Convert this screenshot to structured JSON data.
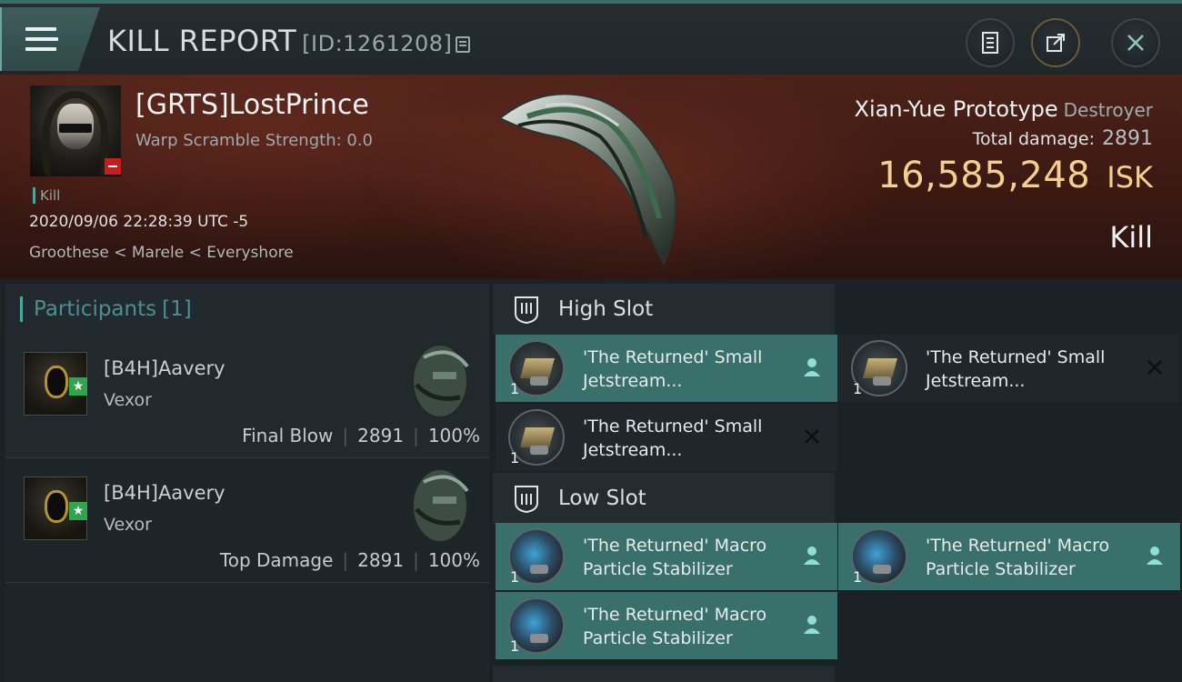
{
  "header": {
    "title": "KILL REPORT",
    "id_label": "[ID:1261208]"
  },
  "victim": {
    "name": "[GRTS]LostPrince",
    "warp_scramble": "Warp Scramble Strength: 0.0",
    "tag": "Kill",
    "timestamp": "2020/09/06 22:28:39 UTC -5",
    "location": "Groothese < Marele < Everyshore",
    "ship_name": "Xian-Yue Prototype",
    "ship_class": "Destroyer",
    "total_damage_label": "Total damage:",
    "total_damage": "2891",
    "isk_value": "16,585,248",
    "isk_unit": "ISK",
    "result": "Kill"
  },
  "participants": {
    "title": "Participants",
    "count": "[1]",
    "rows": [
      {
        "name": "[B4H]Aavery",
        "ship": "Vexor",
        "role": "Final Blow",
        "damage": "2891",
        "percent": "100%"
      },
      {
        "name": "[B4H]Aavery",
        "ship": "Vexor",
        "role": "Top Damage",
        "damage": "2891",
        "percent": "100%"
      }
    ]
  },
  "slots": {
    "high_title": "High Slot",
    "low_title": "Low Slot",
    "high": [
      {
        "line1": "'The Returned' Small",
        "line2": "Jetstream...",
        "qty": "1",
        "status": "dropped"
      },
      {
        "line1": "'The Returned' Small",
        "line2": "Jetstream...",
        "qty": "1",
        "status": "destroyed"
      },
      {
        "line1": "'The Returned' Small",
        "line2": "Jetstream...",
        "qty": "1",
        "status": "destroyed"
      }
    ],
    "low": [
      {
        "line1": "'The Returned' Macro",
        "line2": "Particle Stabilizer",
        "qty": "1",
        "status": "dropped"
      },
      {
        "line1": "'The Returned' Macro",
        "line2": "Particle Stabilizer",
        "qty": "1",
        "status": "dropped"
      },
      {
        "line1": "'The Returned' Macro",
        "line2": "Particle Stabilizer",
        "qty": "1",
        "status": "dropped"
      }
    ]
  },
  "colors": {
    "accent": "#4aa79b",
    "isk": "#f5cf8c",
    "fitted_bg": "#3a706c"
  }
}
